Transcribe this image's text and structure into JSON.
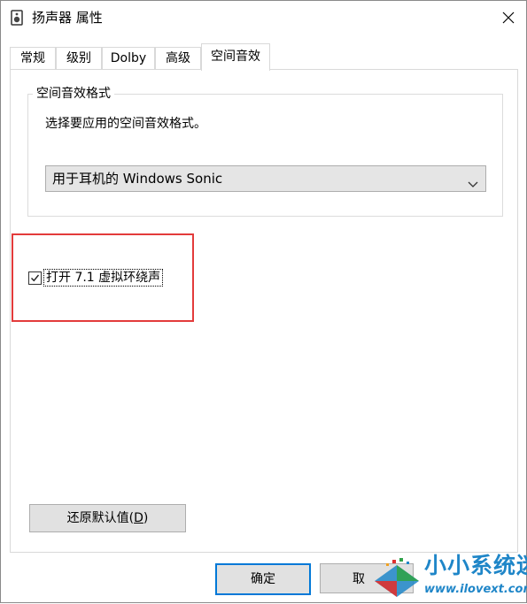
{
  "window": {
    "title": "扬声器 属性",
    "icon": "speaker-icon",
    "close_icon": "close-icon"
  },
  "tabs": [
    {
      "label": "常规",
      "active": false
    },
    {
      "label": "级别",
      "active": false
    },
    {
      "label": "Dolby",
      "active": false
    },
    {
      "label": "高级",
      "active": false
    },
    {
      "label": "空间音效",
      "active": true
    }
  ],
  "spatial_sound": {
    "group_title": "空间音效格式",
    "description": "选择要应用的空间音效格式。",
    "selected_format": "用于耳机的 Windows Sonic",
    "virtual_surround": {
      "label": "打开 7.1 虚拟环绕声",
      "checked": true
    }
  },
  "buttons": {
    "restore_default_prefix": "还原默认值(",
    "restore_default_key": "D",
    "restore_default_suffix": ")",
    "ok": "确定",
    "cancel": "取"
  },
  "watermark": {
    "title": "小小系统迷",
    "url": "www.ilovext.com"
  },
  "colors": {
    "highlight_border": "#e33b3b",
    "focus_border": "#0078d7",
    "watermark_blue": "#1f86c8"
  }
}
